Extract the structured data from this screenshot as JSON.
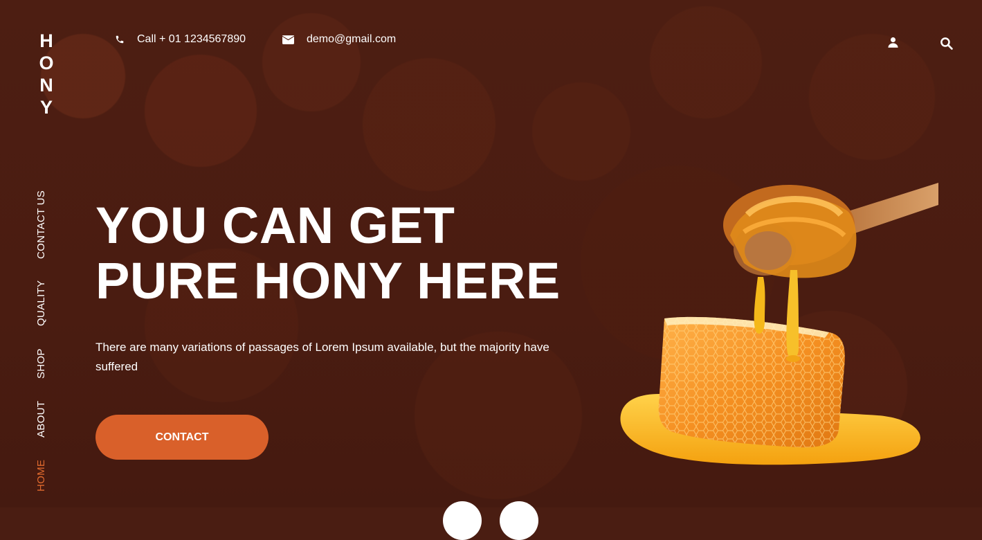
{
  "brand": {
    "logo_letters": [
      "H",
      "O",
      "N",
      "Y"
    ]
  },
  "nav": {
    "items": [
      {
        "label": "HOME",
        "active": true
      },
      {
        "label": "ABOUT",
        "active": false
      },
      {
        "label": "SHOP",
        "active": false
      },
      {
        "label": "QUALITY",
        "active": false
      },
      {
        "label": "CONTACT US",
        "active": false
      }
    ]
  },
  "topbar": {
    "phone": "Call + 01 1234567890",
    "email": "demo@gmail.com",
    "icons": [
      "phone-icon",
      "envelope-icon",
      "user-icon",
      "search-icon"
    ]
  },
  "hero": {
    "title_line1": "YOU CAN GET",
    "title_line2": "PURE HONY HERE",
    "text": "There are many variations of passages of Lorem Ipsum available, but the majority have suffered",
    "button_label": "CONTACT",
    "slider_dot_count": 2
  },
  "colors": {
    "background": "#4a1d12",
    "accent": "#d9602a",
    "active_nav": "#e06a2e",
    "text": "#ffffff"
  }
}
